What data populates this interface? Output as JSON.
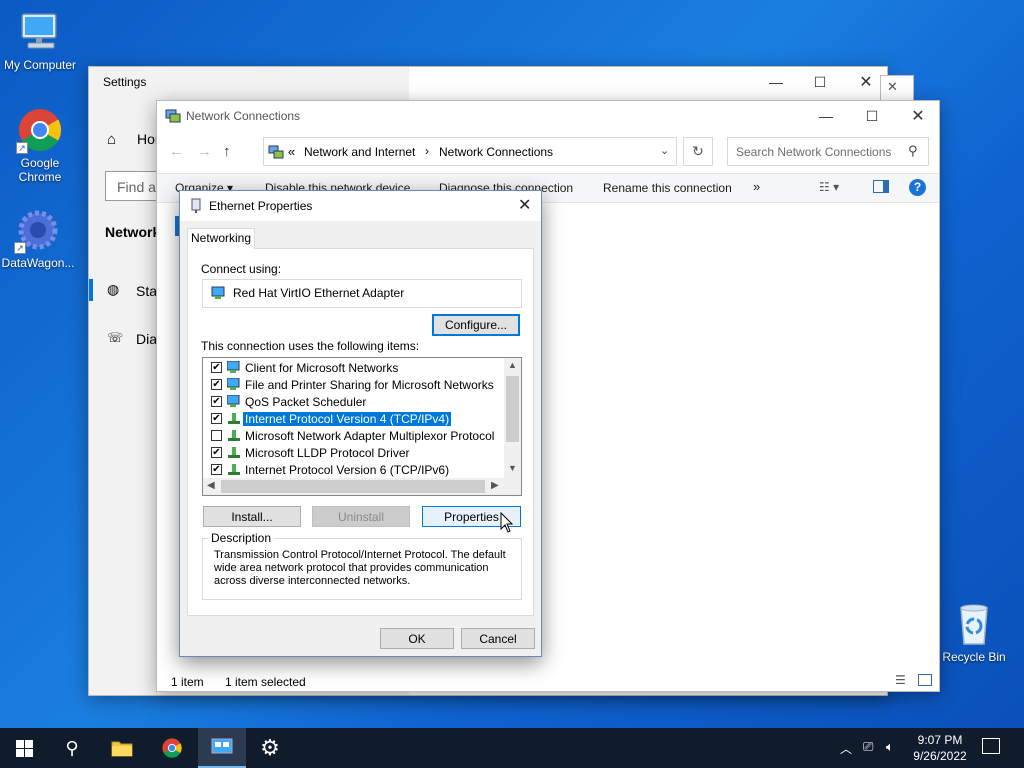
{
  "desktop": {
    "icons": [
      {
        "label": "My Computer",
        "icon": "computer-icon"
      },
      {
        "label": "Google\nChrome",
        "label_line1": "Google",
        "label_line2": "Chrome",
        "icon": "chrome-icon"
      },
      {
        "label": "DataWagon...",
        "icon": "datawagon-icon"
      },
      {
        "label": "Recycle Bin",
        "icon": "recycle-bin-icon"
      }
    ]
  },
  "settings": {
    "title": "Settings",
    "home_label": "Hom",
    "search_placeholder": "Find a",
    "section_title": "Network",
    "nav": [
      {
        "label": "Stat",
        "icon": "globe-icon"
      },
      {
        "label": "Dia",
        "icon": "dial-up-icon"
      }
    ]
  },
  "netconn": {
    "title": "Network Connections",
    "breadcrumb": {
      "prefix": "«",
      "part1": "Network and Internet",
      "part2": "Network Connections"
    },
    "search_placeholder": "Search Network Connections",
    "toolbar": {
      "organize": "Organize",
      "disable": "Disable this network device",
      "diagnose": "Diagnose this connection",
      "rename": "Rename this connection",
      "more": "»"
    },
    "status": {
      "count": "1 item",
      "selected": "1 item selected"
    }
  },
  "dialog": {
    "title": "Ethernet Properties",
    "tab": "Networking",
    "connect_using_label": "Connect using:",
    "adapter": "Red Hat VirtIO Ethernet Adapter",
    "configure": "Configure...",
    "items_label": "This connection uses the following items:",
    "items": [
      {
        "label": "Client for Microsoft Networks",
        "checked": "✔",
        "icon": "network-client-icon"
      },
      {
        "label": "File and Printer Sharing for Microsoft Networks",
        "checked": "✔",
        "icon": "network-service-icon"
      },
      {
        "label": "QoS Packet Scheduler",
        "checked": "✔",
        "icon": "network-service-icon"
      },
      {
        "label": "Internet Protocol Version 4 (TCP/IPv4)",
        "checked": "✔",
        "icon": "protocol-icon",
        "selected": true
      },
      {
        "label": "Microsoft Network Adapter Multiplexor Protocol",
        "checked": "",
        "icon": "protocol-icon"
      },
      {
        "label": "Microsoft LLDP Protocol Driver",
        "checked": "✔",
        "icon": "protocol-icon"
      },
      {
        "label": "Internet Protocol Version 6 (TCP/IPv6)",
        "checked": "✔",
        "icon": "protocol-icon"
      }
    ],
    "install": "Install...",
    "uninstall": "Uninstall",
    "properties": "Properties",
    "description_label": "Description",
    "description": "Transmission Control Protocol/Internet Protocol. The default wide area network protocol that provides communication across diverse interconnected networks.",
    "ok": "OK",
    "cancel": "Cancel"
  },
  "taskbar": {
    "time": "9:07 PM",
    "date": "9/26/2022"
  },
  "colors": {
    "accent": "#0078d7",
    "taskbar": "#101b2c",
    "desktop": "#0f63d0"
  }
}
